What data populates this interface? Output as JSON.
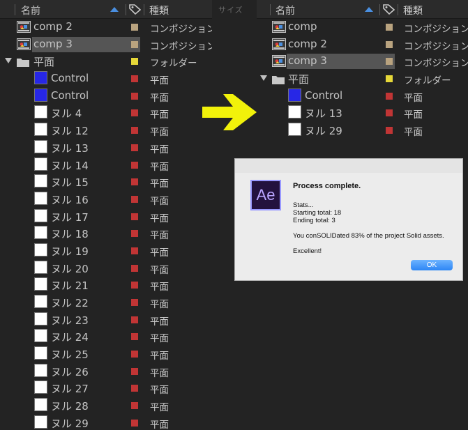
{
  "left_panel": {
    "header": {
      "name_col": "名前",
      "type_col": "種類",
      "hidden_col": "サイズ"
    },
    "rows": [
      {
        "name": "comp 2",
        "type": "コンポジション",
        "kind": "comp",
        "label_color": "#b9a37f",
        "indent": 0,
        "selected": false
      },
      {
        "name": "comp 3",
        "type": "コンポジション",
        "kind": "comp",
        "label_color": "#b9a37f",
        "indent": 0,
        "selected": true
      },
      {
        "name": "平面",
        "type": "フォルダー",
        "kind": "folder",
        "label_color": "#e6d839",
        "indent": 0,
        "selected": false,
        "expanded": true
      },
      {
        "name": "Control",
        "type": "平面",
        "kind": "solid",
        "swatch": "#2727e6",
        "label_color": "#c13535",
        "indent": 1,
        "selected": false
      },
      {
        "name": "Control",
        "type": "平面",
        "kind": "solid",
        "swatch": "#2727e6",
        "label_color": "#c13535",
        "indent": 1,
        "selected": false
      },
      {
        "name": "ヌル 4",
        "type": "平面",
        "kind": "solid",
        "swatch": "#ffffff",
        "label_color": "#c13535",
        "indent": 1,
        "selected": false
      },
      {
        "name": "ヌル 12",
        "type": "平面",
        "kind": "solid",
        "swatch": "#ffffff",
        "label_color": "#c13535",
        "indent": 1,
        "selected": false
      },
      {
        "name": "ヌル 13",
        "type": "平面",
        "kind": "solid",
        "swatch": "#ffffff",
        "label_color": "#c13535",
        "indent": 1,
        "selected": false
      },
      {
        "name": "ヌル 14",
        "type": "平面",
        "kind": "solid",
        "swatch": "#ffffff",
        "label_color": "#c13535",
        "indent": 1,
        "selected": false
      },
      {
        "name": "ヌル 15",
        "type": "平面",
        "kind": "solid",
        "swatch": "#ffffff",
        "label_color": "#c13535",
        "indent": 1,
        "selected": false
      },
      {
        "name": "ヌル 16",
        "type": "平面",
        "kind": "solid",
        "swatch": "#ffffff",
        "label_color": "#c13535",
        "indent": 1,
        "selected": false
      },
      {
        "name": "ヌル 17",
        "type": "平面",
        "kind": "solid",
        "swatch": "#ffffff",
        "label_color": "#c13535",
        "indent": 1,
        "selected": false
      },
      {
        "name": "ヌル 18",
        "type": "平面",
        "kind": "solid",
        "swatch": "#ffffff",
        "label_color": "#c13535",
        "indent": 1,
        "selected": false
      },
      {
        "name": "ヌル 19",
        "type": "平面",
        "kind": "solid",
        "swatch": "#ffffff",
        "label_color": "#c13535",
        "indent": 1,
        "selected": false
      },
      {
        "name": "ヌル 20",
        "type": "平面",
        "kind": "solid",
        "swatch": "#ffffff",
        "label_color": "#c13535",
        "indent": 1,
        "selected": false
      },
      {
        "name": "ヌル 21",
        "type": "平面",
        "kind": "solid",
        "swatch": "#ffffff",
        "label_color": "#c13535",
        "indent": 1,
        "selected": false
      },
      {
        "name": "ヌル 22",
        "type": "平面",
        "kind": "solid",
        "swatch": "#ffffff",
        "label_color": "#c13535",
        "indent": 1,
        "selected": false
      },
      {
        "name": "ヌル 23",
        "type": "平面",
        "kind": "solid",
        "swatch": "#ffffff",
        "label_color": "#c13535",
        "indent": 1,
        "selected": false
      },
      {
        "name": "ヌル 24",
        "type": "平面",
        "kind": "solid",
        "swatch": "#ffffff",
        "label_color": "#c13535",
        "indent": 1,
        "selected": false
      },
      {
        "name": "ヌル 25",
        "type": "平面",
        "kind": "solid",
        "swatch": "#ffffff",
        "label_color": "#c13535",
        "indent": 1,
        "selected": false
      },
      {
        "name": "ヌル 26",
        "type": "平面",
        "kind": "solid",
        "swatch": "#ffffff",
        "label_color": "#c13535",
        "indent": 1,
        "selected": false
      },
      {
        "name": "ヌル 27",
        "type": "平面",
        "kind": "solid",
        "swatch": "#ffffff",
        "label_color": "#c13535",
        "indent": 1,
        "selected": false
      },
      {
        "name": "ヌル 28",
        "type": "平面",
        "kind": "solid",
        "swatch": "#ffffff",
        "label_color": "#c13535",
        "indent": 1,
        "selected": false
      },
      {
        "name": "ヌル 29",
        "type": "平面",
        "kind": "solid",
        "swatch": "#ffffff",
        "label_color": "#c13535",
        "indent": 1,
        "selected": false
      }
    ]
  },
  "right_panel": {
    "header": {
      "name_col": "名前",
      "type_col": "種類"
    },
    "rows": [
      {
        "name": "comp",
        "type": "コンポジション",
        "kind": "comp",
        "label_color": "#b9a37f",
        "indent": 0,
        "selected": false
      },
      {
        "name": "comp 2",
        "type": "コンポジション",
        "kind": "comp",
        "label_color": "#b9a37f",
        "indent": 0,
        "selected": false
      },
      {
        "name": "comp 3",
        "type": "コンポジション",
        "kind": "comp",
        "label_color": "#b9a37f",
        "indent": 0,
        "selected": true
      },
      {
        "name": "平面",
        "type": "フォルダー",
        "kind": "folder",
        "label_color": "#e6d839",
        "indent": 0,
        "selected": false,
        "expanded": true
      },
      {
        "name": "Control",
        "type": "平面",
        "kind": "solid",
        "swatch": "#2727e6",
        "label_color": "#c13535",
        "indent": 1,
        "selected": false
      },
      {
        "name": "ヌル 13",
        "type": "平面",
        "kind": "solid",
        "swatch": "#ffffff",
        "label_color": "#c13535",
        "indent": 1,
        "selected": false
      },
      {
        "name": "ヌル 29",
        "type": "平面",
        "kind": "solid",
        "swatch": "#ffffff",
        "label_color": "#c13535",
        "indent": 1,
        "selected": false
      }
    ]
  },
  "arrow": {
    "color": "#f2f20a"
  },
  "dialog": {
    "icon_text": "Ae",
    "title": "Process complete.",
    "stats_heading": "Stats...",
    "starting_total": "Starting total: 18",
    "ending_total": "Ending total: 3",
    "summary": "You conSOLIDated 83% of the project Solid assets.",
    "closing": "Excellent!",
    "ok_label": "OK"
  }
}
